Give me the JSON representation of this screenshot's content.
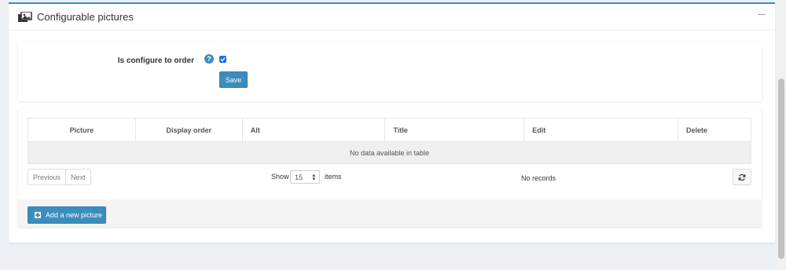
{
  "card": {
    "title": "Configurable pictures",
    "icon": "pictures-icon"
  },
  "form": {
    "label": "Is configure to order",
    "help": "?",
    "checked": true,
    "save_label": "Save"
  },
  "table": {
    "columns": [
      "Picture",
      "Display order",
      "Alt",
      "Title",
      "Edit",
      "Delete"
    ],
    "empty_text": "No data available in table"
  },
  "pager": {
    "previous": "Previous",
    "next": "Next",
    "show": "Show",
    "page_size": "15",
    "items": "items",
    "records": "No records"
  },
  "add_button": "Add a new picture",
  "colors": {
    "accent": "#3c8dbc",
    "background": "#ecf0f5"
  }
}
